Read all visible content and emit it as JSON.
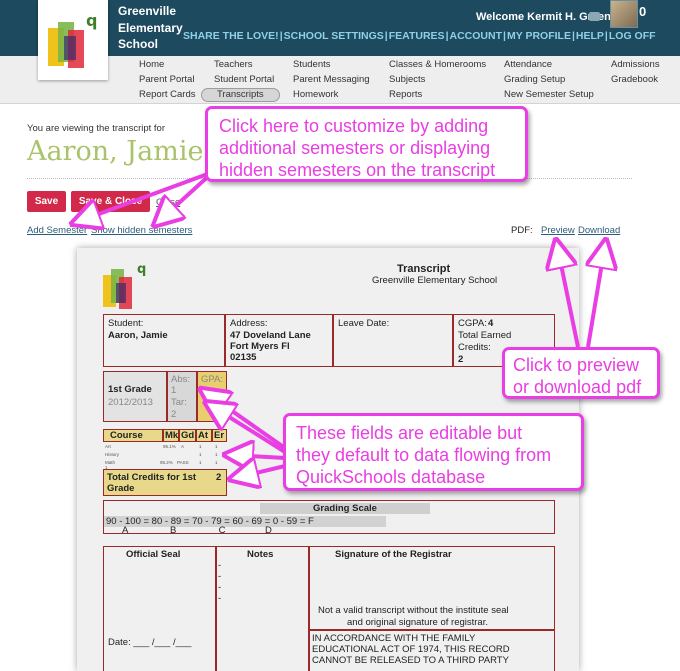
{
  "header": {
    "school_name": "Greenville Elementary School",
    "welcome": "Welcome Kermit H. Green",
    "notification_count": "0",
    "top_nav": [
      "SHARE THE LOVE!",
      "SCHOOL SETTINGS",
      "FEATURES",
      "ACCOUNT",
      "MY PROFILE",
      "HELP",
      "LOG OFF"
    ]
  },
  "subnav": {
    "home": "Home",
    "parent_portal": "Parent Portal",
    "report_cards": "Report Cards",
    "teachers": "Teachers",
    "student_portal": "Student Portal",
    "transcripts": "Transcripts",
    "students": "Students",
    "parent_messaging": "Parent Messaging",
    "homework": "Homework",
    "classes_homerooms": "Classes & Homerooms",
    "subjects": "Subjects",
    "reports": "Reports",
    "attendance": "Attendance",
    "grading_setup": "Grading Setup",
    "new_semester_setup": "New Semester Setup",
    "admissions": "Admissions",
    "gradebook": "Gradebook"
  },
  "page": {
    "viewing_label": "You are viewing the transcript for",
    "student_name": "Aaron, Jamie",
    "save_label": "Save",
    "save_close_label": "Save & Close",
    "close_label": "Close",
    "add_semester": "Add Semester",
    "show_hidden": "Show hidden semesters",
    "pdf_label": "PDF:",
    "preview": "Preview",
    "download": "Download"
  },
  "transcript": {
    "title": "Transcript",
    "school": "Greenville Elementary School",
    "student_label": "Student:",
    "student_value": "Aaron, Jamie",
    "address_label": "Address:",
    "address_line1": "47 Doveland Lane",
    "address_line2": "Fort Myers Fl",
    "address_line3": "02135",
    "leave_date_label": "Leave Date:",
    "cgpa_label": "CGPA:",
    "cgpa_value": "4",
    "total_earned_label": "Total Earned",
    "credits_label": "Credits:",
    "credits_value": "2",
    "grade": "1st Grade",
    "year": "2012/2013",
    "abs_label": "Abs:",
    "abs_value": "1",
    "tar_label": "Tar:",
    "tar_value": "2",
    "gpa_label": "GPA:",
    "gpa_value": "4",
    "course_label": "Course",
    "col_mk": "Mk",
    "col_gd": "Gd",
    "col_at": "At",
    "col_er": "Er",
    "courses": [
      {
        "name": "Art",
        "mk": "95.1%",
        "gd": "A",
        "at": "1",
        "er": "1"
      },
      {
        "name": "History",
        "mk": "",
        "gd": "",
        "at": "1",
        "er": "1"
      },
      {
        "name": "Math 1",
        "mk": "95.2%",
        "gd": "PASS",
        "at": "1",
        "er": "1"
      }
    ],
    "total_credits_label": "Total Credits for 1st Grade",
    "total_credits_value": "2",
    "grading_scale_title": "Grading Scale",
    "grading_scale_ranges": "90 - 100 =  80 - 89 =   70 - 79 =   60 - 69 =  0 - 59 = F",
    "grading_scale_letters": "A                B                C               D",
    "official_seal": "Official Seal",
    "notes": "Notes",
    "notes_dashes": [
      "-",
      "-",
      "-",
      "-"
    ],
    "signature": "Signature of the Registrar",
    "not_valid_line1": "Not a valid transcript without the institute seal",
    "not_valid_line2": "and original signature of registrar.",
    "date_label": "Date: ___ /___ /___",
    "ferpa_line1": "IN ACCORDANCE WITH THE FAMILY",
    "ferpa_line2": "EDUCATIONAL ACT OF 1974, THIS RECORD",
    "ferpa_line3": "CANNOT BE RELEASED TO A THIRD PARTY"
  },
  "callouts": {
    "customize": [
      "Click here to customize by adding",
      "additional semesters or displaying",
      "hidden semesters on the transcript"
    ],
    "pdf": [
      "Click to preview",
      "or download pdf"
    ],
    "editable": [
      "These fields are editable but",
      "they default to data flowing from",
      "QuickSchools database"
    ]
  },
  "colors": {
    "header_bg": "#1d4a5e",
    "accent_pink": "#e83ee3",
    "save_red": "#d2294a",
    "name_green": "#a9c36a",
    "link_blue": "#2b5c7b"
  }
}
